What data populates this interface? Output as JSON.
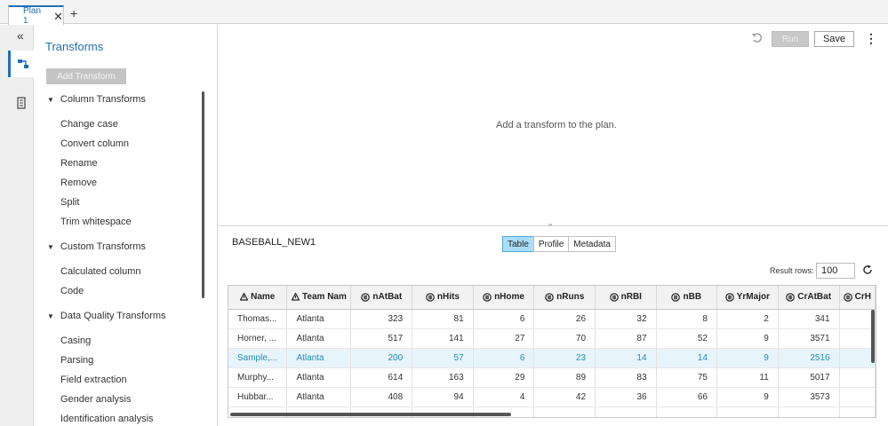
{
  "tabs": [
    {
      "label": "Plan 1",
      "close": "✕"
    }
  ],
  "tab_add": "+",
  "rail": {
    "collapse": "«"
  },
  "panel": {
    "title": "Transforms",
    "add_button": "Add Transform",
    "groups": [
      {
        "title": "Column Transforms",
        "items": [
          "Change case",
          "Convert column",
          "Rename",
          "Remove",
          "Split",
          "Trim whitespace"
        ]
      },
      {
        "title": "Custom Transforms",
        "items": [
          "Calculated column",
          "Code"
        ]
      },
      {
        "title": "Data Quality Transforms",
        "items": [
          "Casing",
          "Parsing",
          "Field extraction",
          "Gender analysis",
          "Identification analysis"
        ]
      }
    ]
  },
  "toolbar": {
    "run": "Run",
    "save": "Save",
    "more": "⋮"
  },
  "plan_message": "Add a transform to the plan.",
  "dataset": {
    "name": "BASEBALL_NEW1",
    "view_tabs": [
      "Table",
      "Profile",
      "Metadata"
    ],
    "active_view": "Table",
    "result_rows_label": "Result rows:",
    "result_rows_value": "100"
  },
  "table": {
    "columns": [
      {
        "name": "Name",
        "type": "char"
      },
      {
        "name": "Team Nam",
        "type": "char"
      },
      {
        "name": "nAtBat",
        "type": "num"
      },
      {
        "name": "nHits",
        "type": "num"
      },
      {
        "name": "nHome",
        "type": "num"
      },
      {
        "name": "nRuns",
        "type": "num"
      },
      {
        "name": "nRBI",
        "type": "num"
      },
      {
        "name": "nBB",
        "type": "num"
      },
      {
        "name": "YrMajor",
        "type": "num"
      },
      {
        "name": "CrAtBat",
        "type": "num"
      },
      {
        "name": "CrH",
        "type": "num"
      }
    ],
    "rows": [
      [
        "Thomas...",
        "Atlanta",
        "323",
        "81",
        "6",
        "26",
        "32",
        "8",
        "2",
        "341",
        ""
      ],
      [
        "Horner, ...",
        "Atlanta",
        "517",
        "141",
        "27",
        "70",
        "87",
        "52",
        "9",
        "3571",
        ""
      ],
      [
        "Sample,...",
        "Atlanta",
        "200",
        "57",
        "6",
        "23",
        "14",
        "14",
        "9",
        "2516",
        ""
      ],
      [
        "Murphy...",
        "Atlanta",
        "614",
        "163",
        "29",
        "89",
        "83",
        "75",
        "11",
        "5017",
        ""
      ],
      [
        "Hubbar...",
        "Atlanta",
        "408",
        "94",
        "4",
        "42",
        "36",
        "66",
        "9",
        "3573",
        ""
      ],
      [
        "",
        "",
        "",
        "",
        "",
        "",
        "",
        "",
        "",
        "",
        ""
      ]
    ],
    "selected_row": 2
  },
  "colors": {
    "accent": "#1f6fb5",
    "active_tab_fill": "#a9def7",
    "selected_row": "#e8f4fc"
  }
}
